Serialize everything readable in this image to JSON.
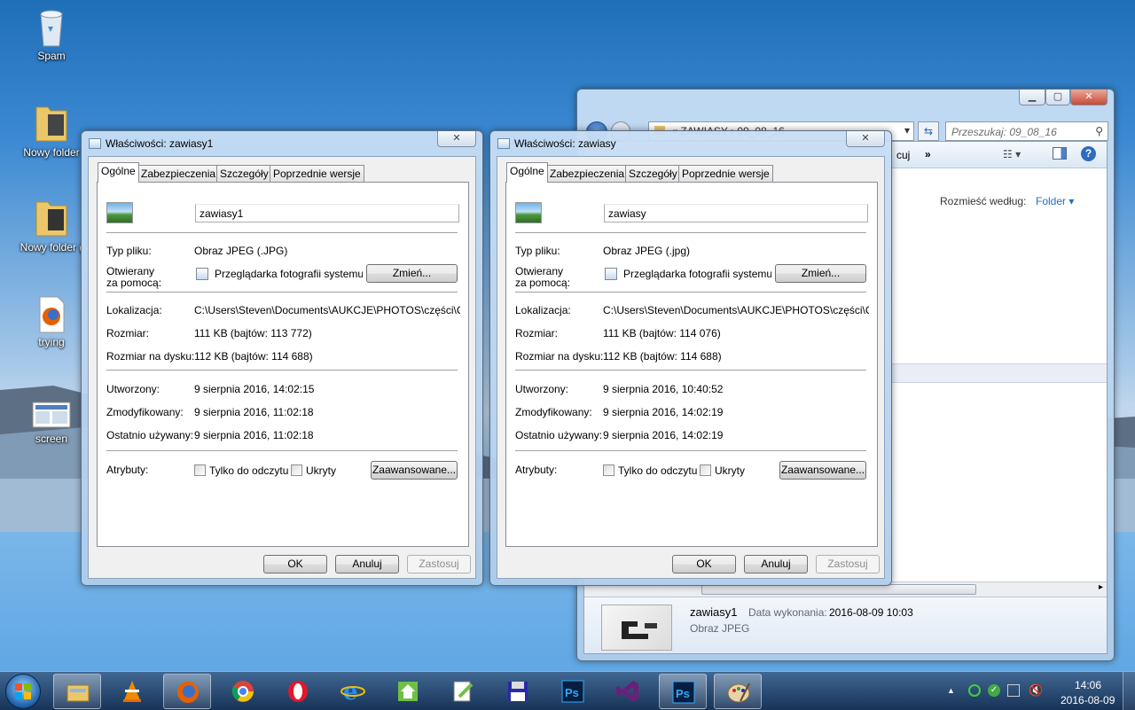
{
  "desktop": {
    "icons": [
      {
        "label": "Spam",
        "icon": "recycle-bin-icon"
      },
      {
        "label": "Nowy folder",
        "icon": "folder-icon"
      },
      {
        "label": "Nowy folder (",
        "icon": "folder-icon"
      },
      {
        "label": "trying",
        "icon": "firefox-shortcut-icon"
      },
      {
        "label": "screen",
        "icon": "image-file-icon"
      }
    ]
  },
  "explorer": {
    "breadcrumb_prefix": "«",
    "breadcrumb": "ZAWIASY",
    "breadcrumb_sep": "›",
    "breadcrumb_current": "09_08_16",
    "search_placeholder": "Przeszukaj: 09_08_16",
    "toolbar_fragment": "cuj",
    "toolbar_more": "»",
    "arrange_label": "Rozmieść według:",
    "arrange_value": "Folder",
    "details": {
      "name": "zawiasy1",
      "date_label": "Data wykonania:",
      "date_value": "2016-08-09 10:03",
      "type": "Obraz JPEG"
    }
  },
  "dialogs": [
    {
      "title": "Właściwości: zawiasy1",
      "tabs": [
        "Ogólne",
        "Zabezpieczenia",
        "Szczegóły",
        "Poprzednie wersje"
      ],
      "filename": "zawiasy1",
      "type_label": "Typ pliku:",
      "type_value": "Obraz JPEG (.JPG)",
      "opens_label_1": "Otwierany",
      "opens_label_2": "za pomocą:",
      "opens_value": "Przeglądarka fotografii systemu Win",
      "change_btn": "Zmień...",
      "location_label": "Lokalizacja:",
      "location_value": "C:\\Users\\Steven\\Documents\\AUKCJE\\PHOTOS\\części\\CZĘŚ",
      "size_label": "Rozmiar:",
      "size_value": "111 KB (bajtów: 113 772)",
      "disk_label": "Rozmiar na dysku:",
      "disk_value": "112 KB (bajtów: 114 688)",
      "created_label": "Utworzony:",
      "created_value": "9 sierpnia 2016, 14:02:15",
      "modified_label": "Zmodyfikowany:",
      "modified_value": "9 sierpnia 2016, 11:02:18",
      "accessed_label": "Ostatnio używany:",
      "accessed_value": "9 sierpnia 2016, 11:02:18",
      "attr_label": "Atrybuty:",
      "readonly_label": "Tylko do odczytu",
      "hidden_label": "Ukryty",
      "advanced_btn": "Zaawansowane...",
      "ok": "OK",
      "cancel": "Anuluj",
      "apply": "Zastosuj"
    },
    {
      "title": "Właściwości: zawiasy",
      "tabs": [
        "Ogólne",
        "Zabezpieczenia",
        "Szczegóły",
        "Poprzednie wersje"
      ],
      "filename": "zawiasy",
      "type_label": "Typ pliku:",
      "type_value": "Obraz JPEG (.jpg)",
      "opens_label_1": "Otwierany",
      "opens_label_2": "za pomocą:",
      "opens_value": "Przeglądarka fotografii systemu Win",
      "change_btn": "Zmień...",
      "location_label": "Lokalizacja:",
      "location_value": "C:\\Users\\Steven\\Documents\\AUKCJE\\PHOTOS\\części\\CZĘŚ",
      "size_label": "Rozmiar:",
      "size_value": "111 KB (bajtów: 114 076)",
      "disk_label": "Rozmiar na dysku:",
      "disk_value": "112 KB (bajtów: 114 688)",
      "created_label": "Utworzony:",
      "created_value": "9 sierpnia 2016, 10:40:52",
      "modified_label": "Zmodyfikowany:",
      "modified_value": "9 sierpnia 2016, 14:02:19",
      "accessed_label": "Ostatnio używany:",
      "accessed_value": "9 sierpnia 2016, 14:02:19",
      "attr_label": "Atrybuty:",
      "readonly_label": "Tylko do odczytu",
      "hidden_label": "Ukryty",
      "advanced_btn": "Zaawansowane...",
      "ok": "OK",
      "cancel": "Anuluj",
      "apply": "Zastosuj"
    }
  ],
  "taskbar": {
    "time": "14:06",
    "date": "2016-08-09",
    "tray_chevron": "▲",
    "apps": [
      "start",
      "explorer",
      "vlc",
      "firefox",
      "chrome",
      "opera",
      "internet-explorer",
      "upwork",
      "notepadpp",
      "save",
      "photoshop",
      "visual-studio",
      "photoshop",
      "paint"
    ]
  },
  "colors": {
    "accent": "#1e6fc4",
    "title_text": "#000000"
  }
}
